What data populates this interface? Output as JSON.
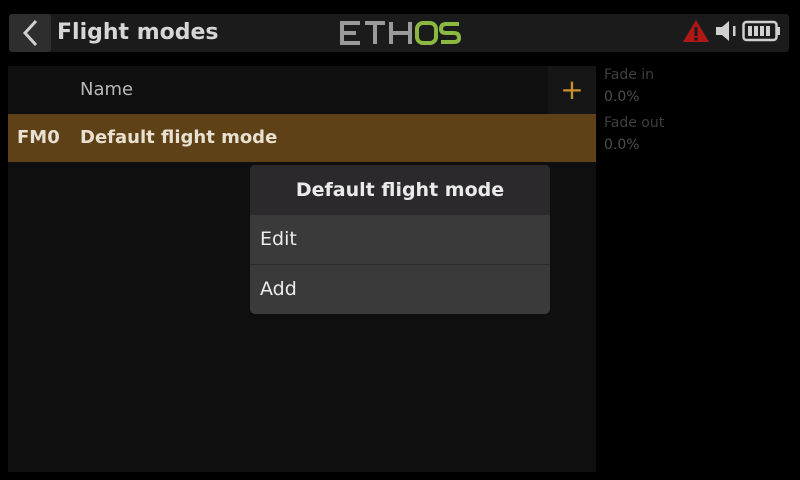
{
  "header": {
    "title": "Flight modes",
    "logo": "ETHOS",
    "logo_colors": {
      "eth": "#9a9a9a",
      "os": "#8ab840"
    },
    "icons": [
      "back-icon",
      "warning-icon",
      "speaker-icon",
      "battery-icon"
    ]
  },
  "list": {
    "column_name": "Name",
    "add_label": "+",
    "rows": [
      {
        "id": "FM0",
        "name": "Default flight mode"
      }
    ]
  },
  "side": {
    "fade_in_label": "Fade in",
    "fade_in_value": "0.0%",
    "fade_out_label": "Fade out",
    "fade_out_value": "0.0%"
  },
  "menu": {
    "title": "Default flight mode",
    "items": [
      "Edit",
      "Add"
    ]
  },
  "colors": {
    "accent": "#c8902c",
    "selected_row": "#5e4116",
    "warning": "#b01818"
  }
}
